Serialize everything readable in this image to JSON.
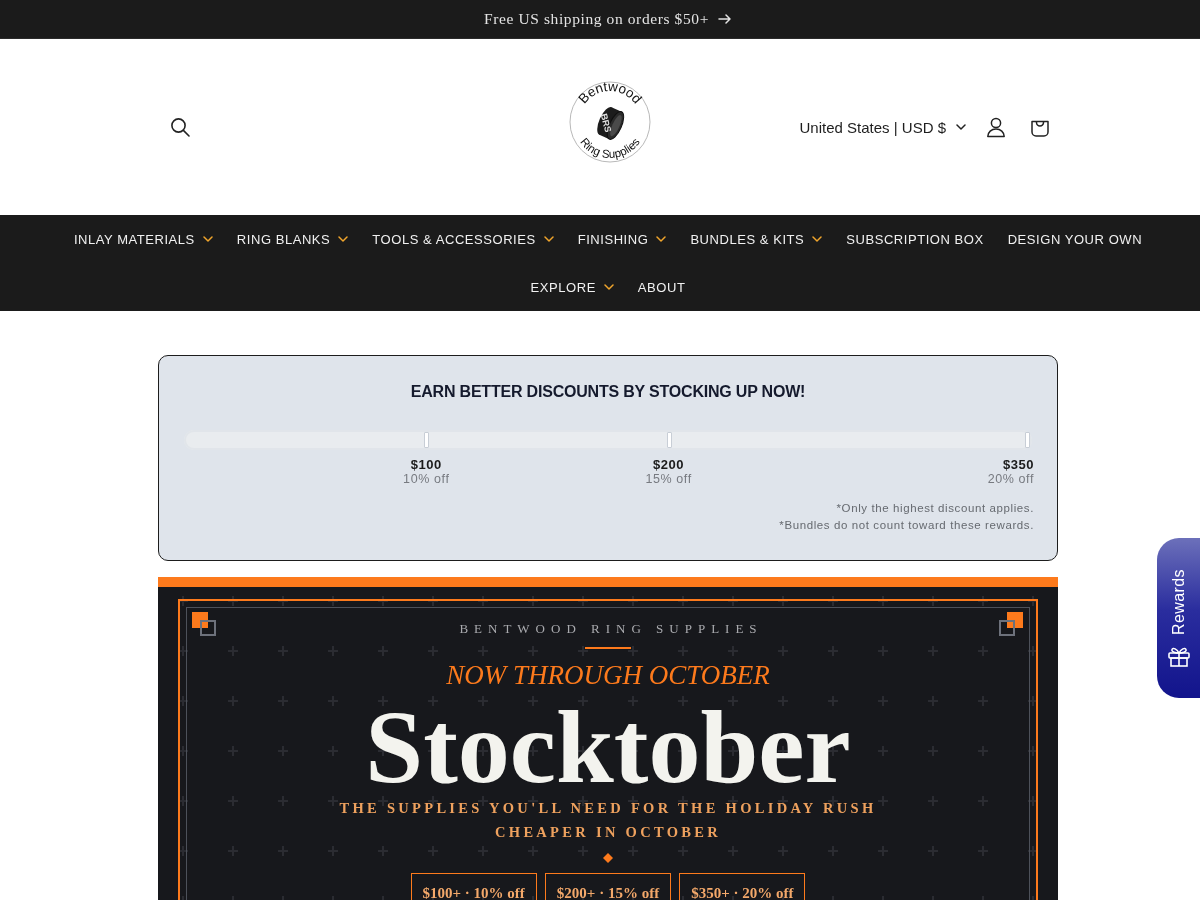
{
  "announcement": {
    "text": "Free US shipping on orders $50+"
  },
  "header": {
    "logo": {
      "top_text": "Bentwood",
      "bottom_text": "Ring Supplies",
      "emblem_text": "BRS"
    },
    "country_selector": "United States | USD $"
  },
  "navigation": {
    "items": [
      {
        "label": "INLAY MATERIALS",
        "has_menu": true
      },
      {
        "label": "RING BLANKS",
        "has_menu": true
      },
      {
        "label": "TOOLS & ACCESSORIES",
        "has_menu": true
      },
      {
        "label": "FINISHING",
        "has_menu": true
      },
      {
        "label": "BUNDLES & KITS",
        "has_menu": true
      },
      {
        "label": "SUBSCRIPTION BOX",
        "has_menu": false
      },
      {
        "label": "DESIGN YOUR OWN",
        "has_menu": false
      },
      {
        "label": "EXPLORE",
        "has_menu": true
      },
      {
        "label": "ABOUT",
        "has_menu": false
      }
    ]
  },
  "discounts": {
    "title": "EARN BETTER DISCOUNTS BY STOCKING UP NOW!",
    "level": 0,
    "tiers": [
      {
        "amount": "$100",
        "discount": "10% off"
      },
      {
        "amount": "$200",
        "discount": "15% off"
      },
      {
        "amount": "$350",
        "discount": "20% off"
      }
    ],
    "notes": [
      "*Only the highest discount applies.",
      "*Bundles do not count toward these rewards."
    ]
  },
  "banner": {
    "eyebrow": "BENTWOOD RING SUPPLIES",
    "kicker": "NOW THROUGH OCTOBER",
    "title": "Stocktober",
    "subtitle": "THE SUPPLIES YOU'LL NEED FOR THE HOLIDAY RUSH CHEAPER IN OCTOBER",
    "offers": [
      "$100+ · 10% off",
      "$200+ · 15% off",
      "$350+ · 20% off"
    ]
  },
  "rewards": {
    "label": "Rewards"
  }
}
